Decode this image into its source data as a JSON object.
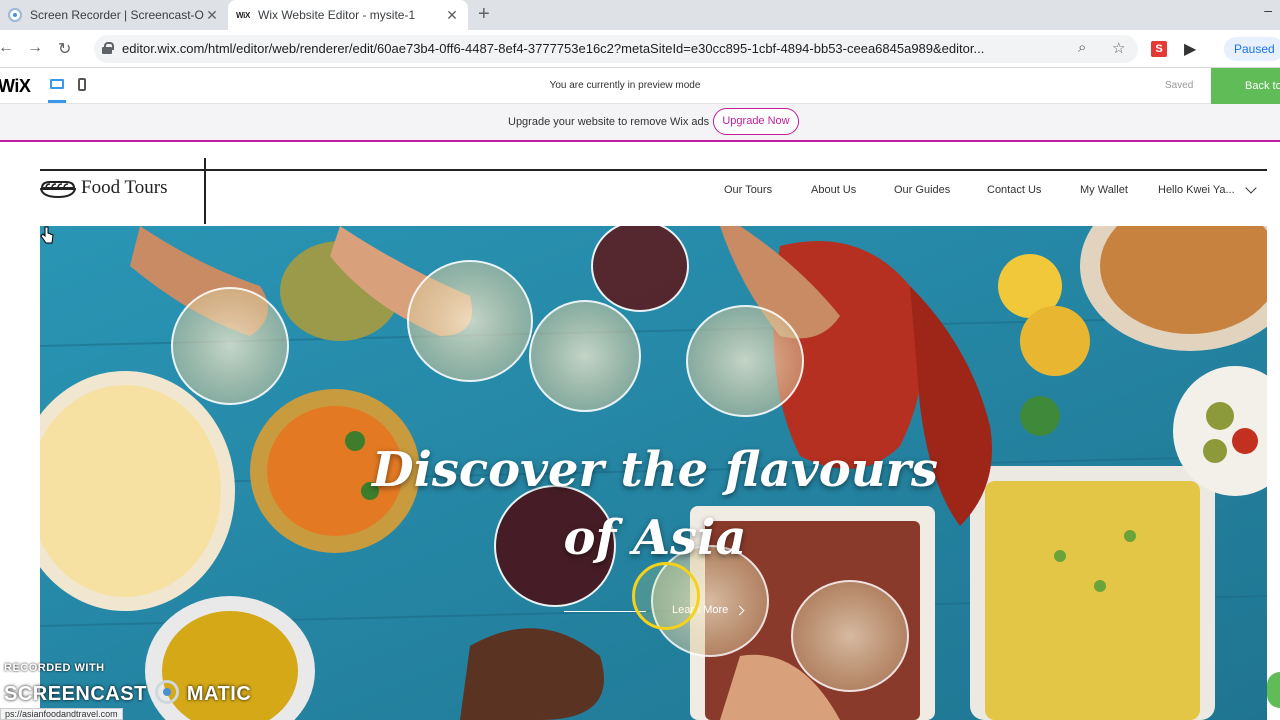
{
  "browser": {
    "tabs": [
      {
        "title": "Screen Recorder | Screencast-O-M",
        "close": "✕"
      },
      {
        "title": "Wix Website Editor - mysite-1",
        "close": "✕"
      }
    ],
    "new_tab": "+",
    "window_min": "–",
    "url": "editor.wix.com/html/editor/web/renderer/edit/60ae73b4-0ff6-4487-8ef4-3777753e16c2?metaSiteId=e30cc895-1cbf-4894-bb53-ceea6845a989&editor...",
    "nav": {
      "back": "←",
      "forward": "→",
      "reload": "↻"
    },
    "omnibox_icons": {
      "zoom": "⌕",
      "star": "☆"
    },
    "extension_s": "S",
    "extension_play": "▶",
    "profile_status": "Paused"
  },
  "wix_bar": {
    "logo": "WiX",
    "preview_message": "You are currently in preview mode",
    "saved_label": "Saved",
    "back_button": "Back to Editor"
  },
  "upgrade_banner": {
    "text": "Upgrade your website to remove Wix ads",
    "button": "Upgrade Now"
  },
  "site": {
    "logo_text": "Food Tours",
    "nav": [
      "Our Tours",
      "About Us",
      "Our Guides",
      "Contact Us",
      "My Wallet",
      "Hello Kwei Ya..."
    ],
    "hero_title": "Discover the flavours of Asia",
    "learn_more": "Learn More"
  },
  "overlays": {
    "recorded_with": "RECORDED WITH",
    "screencast_left": "SCREENCAST",
    "screencast_right": "MATIC",
    "status_url": "ps://asianfoodandtravel.com"
  },
  "colors": {
    "wix_green": "#60bc57",
    "upgrade_magenta": "#c21e9c",
    "wix_blue": "#3899ec",
    "hero_table": "#2c8aa8"
  }
}
